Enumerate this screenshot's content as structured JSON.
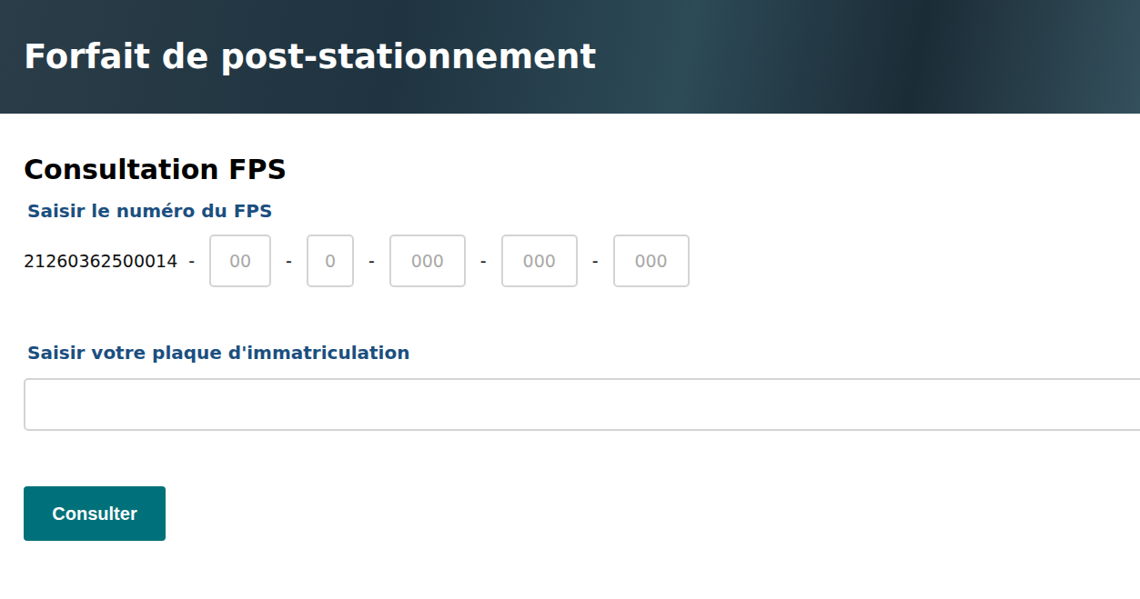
{
  "header": {
    "title": "Forfait de post-stationnement"
  },
  "form": {
    "heading": "Consultation FPS",
    "fps_number": {
      "label": "Saisir le numéro du FPS",
      "prefix": "21260362500014",
      "separator": "-",
      "segments": [
        {
          "placeholder": "00"
        },
        {
          "placeholder": "0"
        },
        {
          "placeholder": "000"
        },
        {
          "placeholder": "000"
        },
        {
          "placeholder": "000"
        }
      ]
    },
    "plate": {
      "label": "Saisir votre plaque d'immatriculation"
    },
    "submit": "Consulter"
  }
}
